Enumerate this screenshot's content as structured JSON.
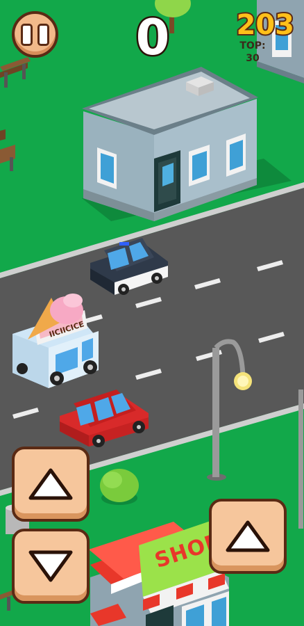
{
  "hud": {
    "score": "0",
    "coins": "203",
    "top_label": "TOP:",
    "top_value": "30",
    "pause_icon": "pause-icon"
  },
  "controls": {
    "left_up_icon": "arrow-up-icon",
    "left_down_icon": "arrow-down-icon",
    "right_up_icon": "arrow-up-icon"
  },
  "scene": {
    "shop_sign": "SHOP",
    "truck_sign": "IICIICICE",
    "colors": {
      "grass": "#12a84a",
      "road": "#585858",
      "button": "#f6c69c",
      "coins": "#ffc01a",
      "police_car": "#2f3a4a",
      "red_car": "#d82a2a",
      "ice_cream_truck": "#cfe6f7"
    }
  }
}
